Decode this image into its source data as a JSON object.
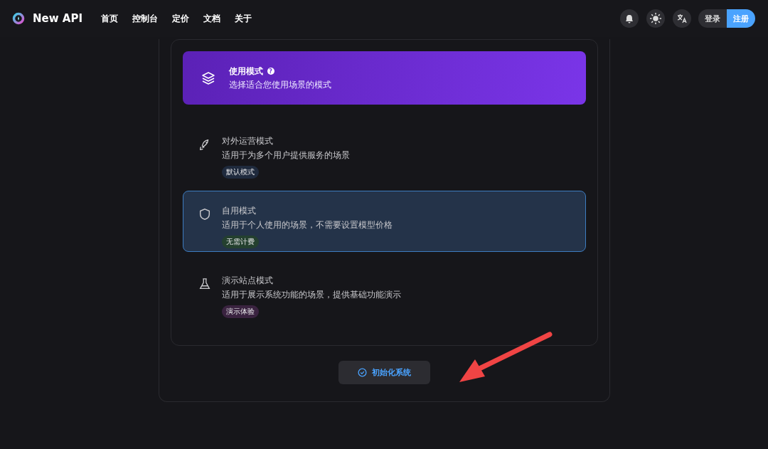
{
  "header": {
    "brand": "New API",
    "nav": [
      {
        "label": "首页"
      },
      {
        "label": "控制台"
      },
      {
        "label": "定价"
      },
      {
        "label": "文档"
      },
      {
        "label": "关于"
      }
    ],
    "login": "登录",
    "register": "注册"
  },
  "banner": {
    "title": "使用模式",
    "help": "?",
    "subtitle": "选择适合您使用场景的模式"
  },
  "modes": [
    {
      "title": "对外运营模式",
      "description": "适用于为多个用户提供服务的场景",
      "tag": "默认模式",
      "color": "#1f2a3d",
      "selected": false
    },
    {
      "title": "自用模式",
      "description": "适用于个人使用的场景，不需要设置模型价格",
      "tag": "无需计费",
      "color": "#24402f",
      "selected": true
    },
    {
      "title": "演示站点模式",
      "description": "适用于展示系统功能的场景，提供基础功能演示",
      "tag": "演示体验",
      "color": "#3a2340",
      "selected": false
    }
  ],
  "submit": "初始化系统"
}
